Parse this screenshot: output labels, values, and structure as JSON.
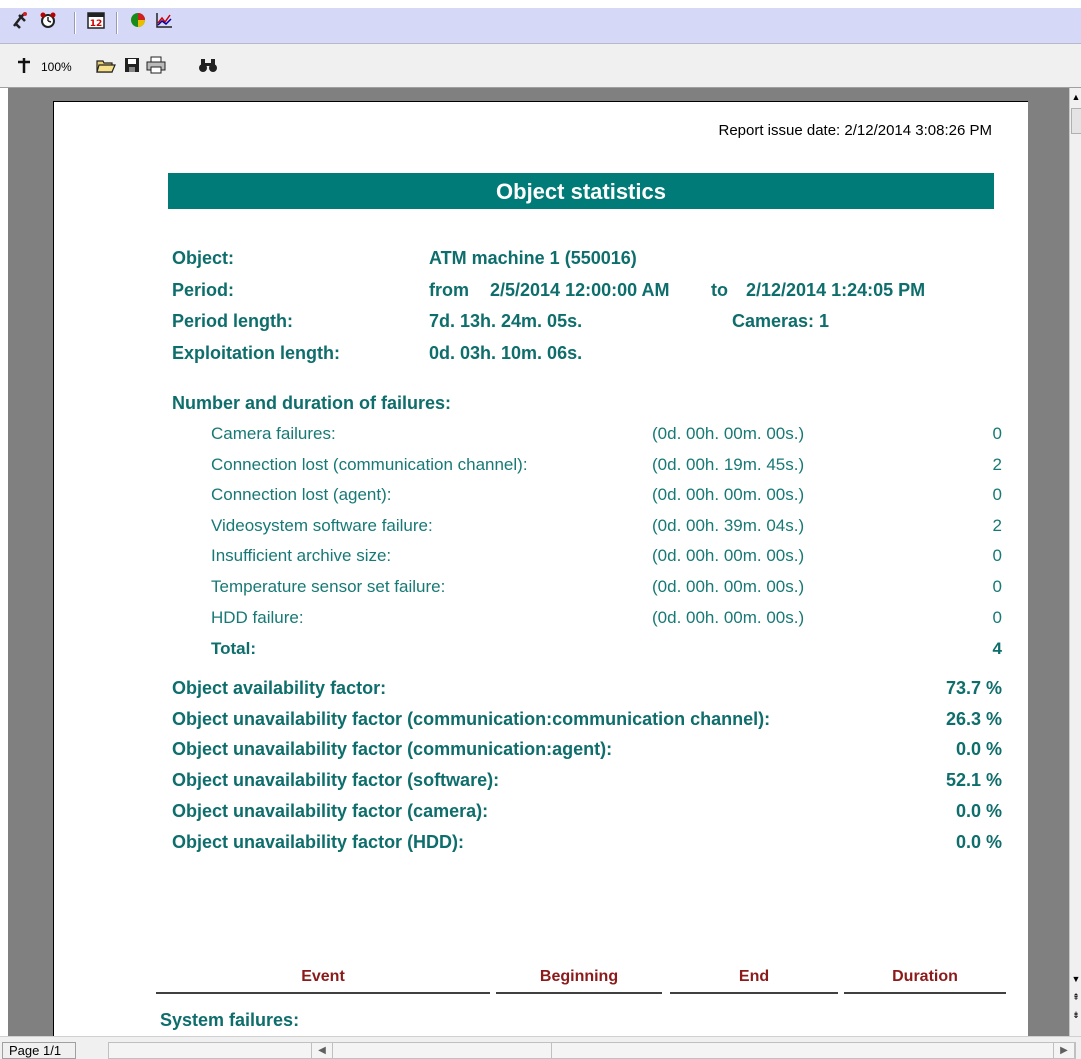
{
  "toolbar": {
    "icons1": [
      "tools-icon",
      "alarm-clock-icon",
      "calendar-icon",
      "pie-chart-icon",
      "line-chart-icon"
    ],
    "zoom_label": "100%",
    "icons2": [
      "zoom-icon",
      "open-folder-icon",
      "save-icon",
      "print-icon",
      "find-icon"
    ]
  },
  "report": {
    "issue_date": "Report issue date: 2/12/2014 3:08:26 PM",
    "title": "Object statistics",
    "object_label": "Object:",
    "object_value": "ATM machine 1 (550016)",
    "period_label": "Period:",
    "period_from": "from",
    "period_start": "2/5/2014 12:00:00 AM",
    "period_to": "to",
    "period_end": "2/12/2014 1:24:05 PM",
    "period_length_label": "Period length:",
    "period_length_value": "7d. 13h. 24m. 05s.",
    "cameras": "Cameras: 1",
    "exploitation_label": "Exploitation length:",
    "exploitation_value": "0d. 03h. 10m. 06s.",
    "failures_heading": "Number and duration of failures:",
    "failures": [
      {
        "label": "Camera failures:",
        "duration": "(0d. 00h. 00m. 00s.)",
        "count": "0"
      },
      {
        "label": "Connection lost (communication channel):",
        "duration": "(0d. 00h. 19m. 45s.)",
        "count": "2"
      },
      {
        "label": "Connection lost (agent):",
        "duration": "(0d. 00h. 00m. 00s.)",
        "count": "0"
      },
      {
        "label": "Videosystem software failure:",
        "duration": "(0d. 00h. 39m. 04s.)",
        "count": "2"
      },
      {
        "label": "Insufficient archive size:",
        "duration": "(0d. 00h. 00m. 00s.)",
        "count": "0"
      },
      {
        "label": "Temperature sensor set failure:",
        "duration": "(0d. 00h. 00m. 00s.)",
        "count": "0"
      },
      {
        "label": "HDD failure:",
        "duration": "(0d. 00h. 00m. 00s.)",
        "count": "0"
      }
    ],
    "total_label": "Total:",
    "total_value": "4",
    "factors": [
      {
        "label": "Object availability factor:",
        "value": "73.7 %"
      },
      {
        "label": "Object unavailability factor (communication:communication channel):",
        "value": "26.3 %"
      },
      {
        "label": "Object unavailability factor (communication:agent):",
        "value": "0.0 %"
      },
      {
        "label": "Object unavailability factor (software):",
        "value": "52.1 %"
      },
      {
        "label": "Object unavailability factor (camera):",
        "value": "0.0 %"
      },
      {
        "label": "Object unavailability factor (HDD):",
        "value": "0.0 %"
      }
    ],
    "columns": [
      "Event",
      "Beginning",
      "End",
      "Duration"
    ],
    "system_failures": "System failures:"
  },
  "status": {
    "page": "Page 1/1"
  }
}
